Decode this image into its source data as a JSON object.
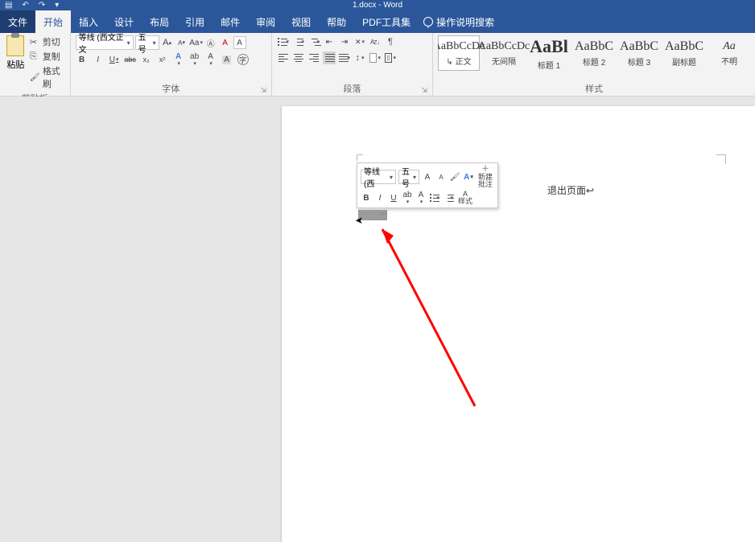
{
  "title": {
    "filename": "1.docx",
    "sep": " - ",
    "app": "Word"
  },
  "qat": {
    "save": "▤",
    "undo": "↶",
    "redo": "↷",
    "more": "▾"
  },
  "tabs": {
    "file": "文件",
    "home": "开始",
    "insert": "插入",
    "design": "设计",
    "layout": "布局",
    "references": "引用",
    "mailings": "邮件",
    "review": "审阅",
    "view": "视图",
    "help": "帮助",
    "pdf": "PDF工具集",
    "tellme": "操作说明搜索"
  },
  "clipboard": {
    "paste": "粘贴",
    "cut": "剪切",
    "copy": "复制",
    "format_painter": "格式刷",
    "group": "剪贴板"
  },
  "font": {
    "name_value": "等线 (西文正文",
    "size_value": "五号",
    "grow": "A",
    "shrink": "A",
    "case": "Aa",
    "clear": "A",
    "bold": "B",
    "italic": "I",
    "underline": "U",
    "strike": "abc",
    "sub": "x₂",
    "sup": "x²",
    "text_effects": "A",
    "highlight": "ab",
    "font_color": "A",
    "char_shading": "A",
    "enclose": "字",
    "group": "字体"
  },
  "paragraph": {
    "group": "段落"
  },
  "styles": {
    "group": "样式",
    "items": [
      {
        "preview": "AaBbCcDc",
        "name": "正文",
        "cls": "pv-normal",
        "selected": true
      },
      {
        "preview": "AaBbCcDc",
        "name": "无间隔",
        "cls": "pv-nospace"
      },
      {
        "preview": "AaBl",
        "name": "标题 1",
        "cls": "pv-h1"
      },
      {
        "preview": "AaBbC",
        "name": "标题 2",
        "cls": "pv-h2"
      },
      {
        "preview": "AaBbC",
        "name": "标题 3",
        "cls": "pv-h3"
      },
      {
        "preview": "AaBbC",
        "name": "副标题",
        "cls": "pv-subtitle"
      },
      {
        "preview": "Aa",
        "name": "不明",
        "cls": "pv-more"
      }
    ]
  },
  "mini": {
    "font_name": "等线 (西",
    "font_size": "五号",
    "styles_label": "样式",
    "new_comment_l1": "新建",
    "new_comment_l2": "批注"
  },
  "document": {
    "body_text": "退出页面↩",
    "selection_mark": "↩"
  }
}
